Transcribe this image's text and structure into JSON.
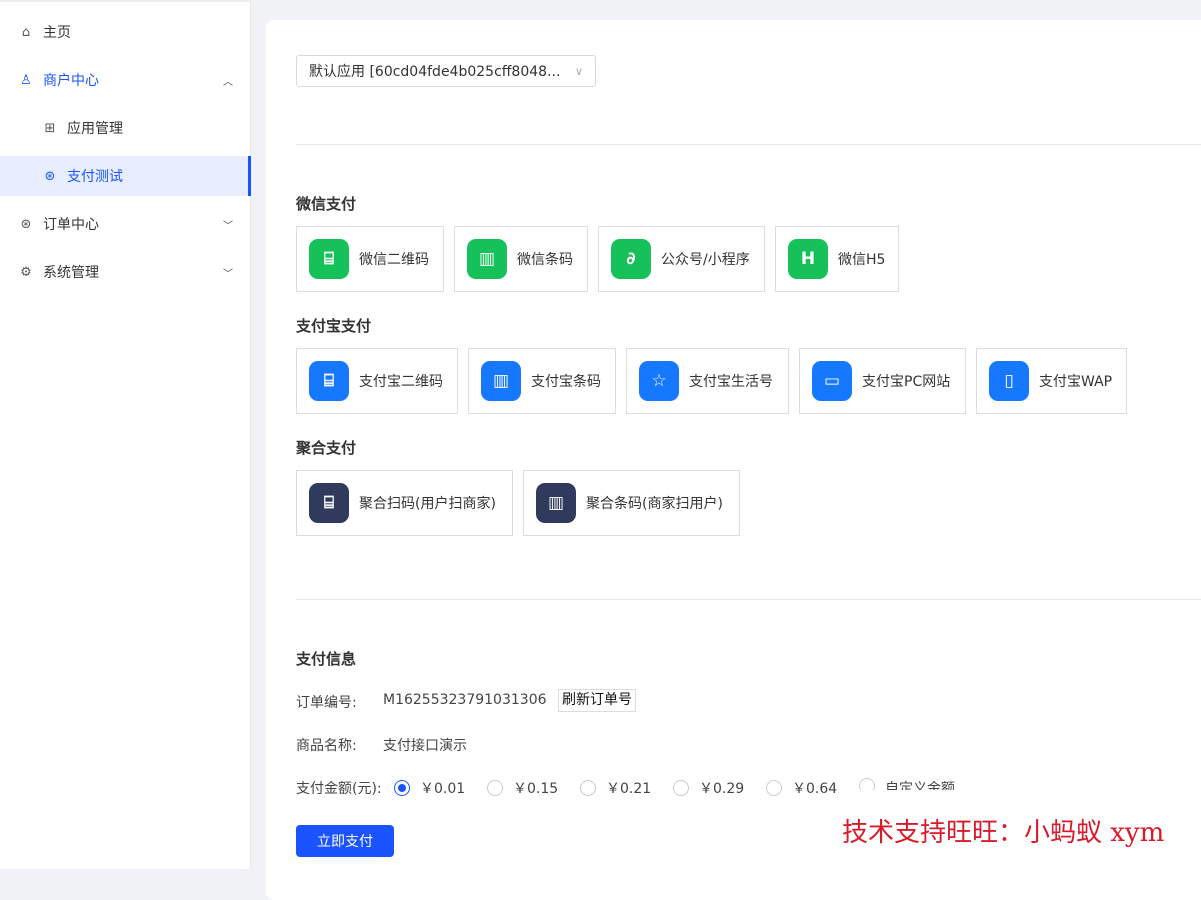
{
  "sidebar": {
    "items": [
      {
        "label": "主页",
        "icon": "home-icon"
      },
      {
        "label": "商户中心",
        "icon": "user-icon",
        "expanded": true
      },
      {
        "label": "应用管理",
        "icon": "grid-icon"
      },
      {
        "label": "支付测试",
        "icon": "payment-icon",
        "active": true
      },
      {
        "label": "订单中心",
        "icon": "order-icon"
      },
      {
        "label": "系统管理",
        "icon": "gear-icon"
      }
    ]
  },
  "app_select": {
    "value": "默认应用 [60cd04fde4b025cff8048..."
  },
  "sections": {
    "wechat": {
      "title": "微信支付",
      "items": [
        "微信二维码",
        "微信条码",
        "公众号/小程序",
        "微信H5"
      ]
    },
    "alipay": {
      "title": "支付宝支付",
      "items": [
        "支付宝二维码",
        "支付宝条码",
        "支付宝生活号",
        "支付宝PC网站",
        "支付宝WAP"
      ]
    },
    "aggregate": {
      "title": "聚合支付",
      "items": [
        "聚合扫码(用户扫商家)",
        "聚合条码(商家扫用户)"
      ]
    }
  },
  "pay_info": {
    "title": "支付信息",
    "order_label": "订单编号:",
    "order_no": "M16255323791031306",
    "refresh_label": "刷新订单号",
    "product_label": "商品名称:",
    "product_name": "支付接口演示",
    "amount_label": "支付金额(元):",
    "amounts": [
      "￥0.01",
      "￥0.15",
      "￥0.21",
      "￥0.29",
      "￥0.64",
      "自定义金额"
    ],
    "selected_amount": "￥0.01",
    "pay_button": "立即支付"
  },
  "watermark": "技术支持旺旺：小蚂蚁 xym",
  "colors": {
    "primary": "#1a53ff",
    "wechat": "#17c15a",
    "alipay": "#1677ff",
    "aggregate": "#2f3a5c",
    "watermark": "#d91a2a"
  }
}
